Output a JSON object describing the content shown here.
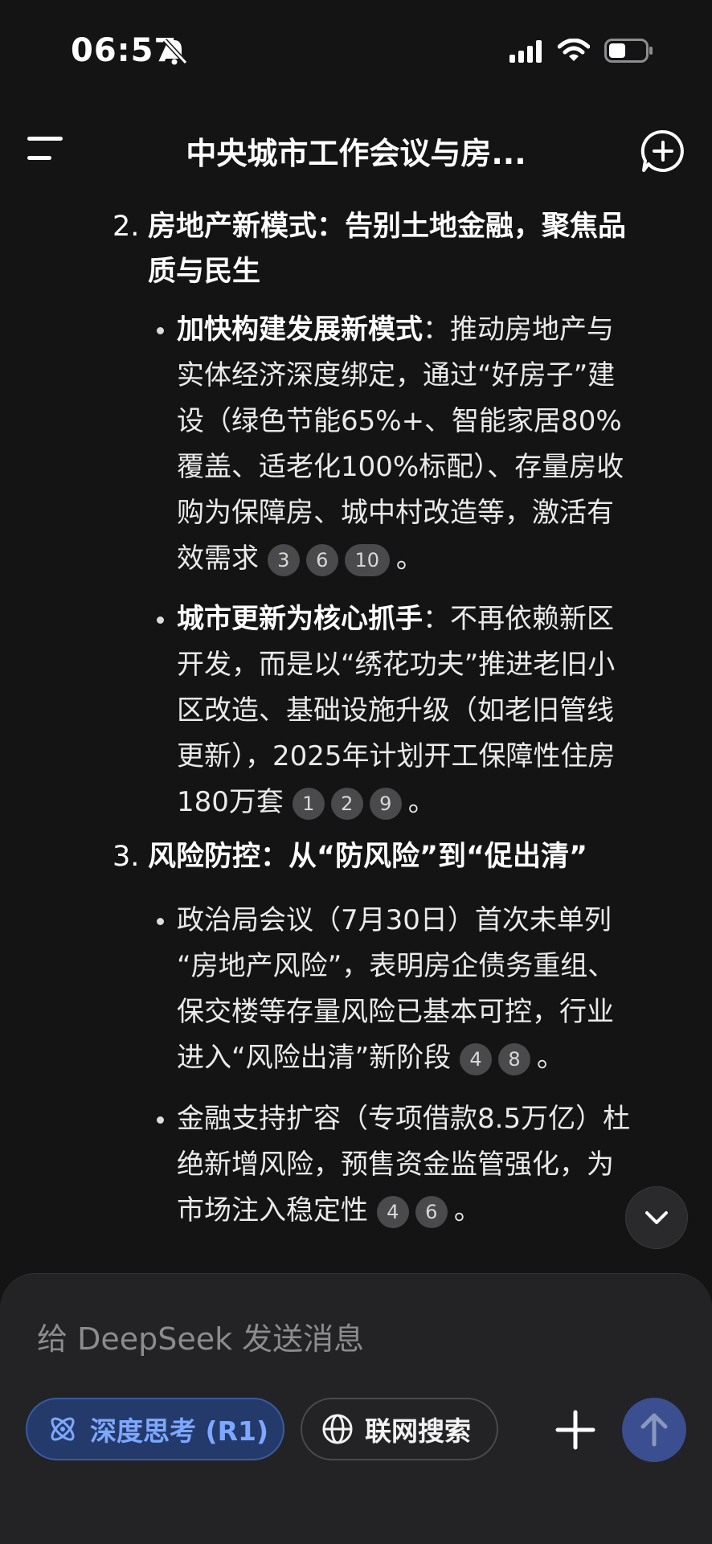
{
  "status_bar": {
    "time": "06:57"
  },
  "header": {
    "title": "中央城市工作会议与房..."
  },
  "content": {
    "section2": {
      "number": "2.",
      "heading_line1": "房地产新模式：告别土地金融，聚焦品",
      "heading_line2": "质与民生",
      "bullets": [
        {
          "bold": "加快构建发展新模式",
          "line1_rest": "：推动房地产与",
          "lines": [
            "实体经济深度绑定，通过“好房子”建",
            "设（绿色节能65%+、智能家居80%",
            "覆盖、适老化100%标配）、存量房收",
            "购为保障房、城中村改造等，激活有"
          ],
          "last_line": "效需求",
          "citations": [
            "3",
            "6",
            "10"
          ],
          "end": "。"
        },
        {
          "bold": "城市更新为核心抓手",
          "line1_rest": "：不再依赖新区",
          "lines": [
            "开发，而是以“绣花功夫”推进老旧小",
            "区改造、基础设施升级（如老旧管线",
            "更新），2025年计划开工保障性住房"
          ],
          "last_line": "180万套",
          "citations": [
            "1",
            "2",
            "9"
          ],
          "end": "。"
        }
      ]
    },
    "section3": {
      "number": "3.",
      "heading_line1": "风险防控：从“防风险”到“促出清”",
      "bullets": [
        {
          "lines": [
            "政治局会议（7月30日）首次未单列",
            "“房地产风险”，表明房企债务重组、",
            "保交楼等存量风险已基本可控，行业"
          ],
          "last_line": "进入“风险出清”新阶段",
          "citations": [
            "4",
            "8"
          ],
          "end": "。"
        },
        {
          "lines": [
            "金融支持扩容（专项借款8.5万亿）杜",
            "绝新增风险，预售资金监管强化，为"
          ],
          "last_line": "市场注入稳定性",
          "citations": [
            "4",
            "6"
          ],
          "end": "。"
        }
      ]
    }
  },
  "composer": {
    "placeholder": "给 DeepSeek 发送消息",
    "deep_think_label": "深度思考 (R1)",
    "web_search_label": "联网搜索"
  },
  "colors": {
    "background": "#141415",
    "accent": "#7ea8ff",
    "send": "#3b4e8f"
  }
}
